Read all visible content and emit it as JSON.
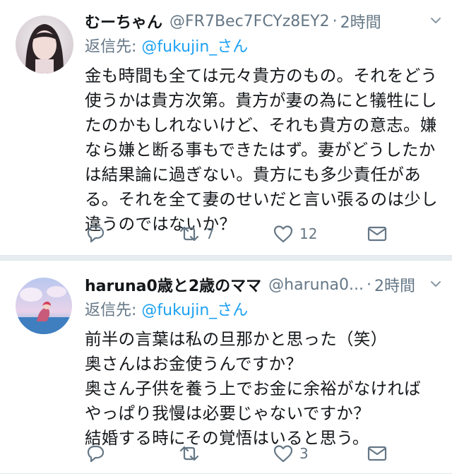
{
  "tweets": [
    {
      "name": "むーちゃん",
      "handle": "@FR7Bec7FCYz8EY2",
      "dot": "·",
      "time": "2時間",
      "reply_prefix": "返信先: ",
      "reply_mention": "@fukujin_さん",
      "body_lines": [
        "金も時間も全ては元々貴方のもの。それをどう",
        "使うかは貴方次第。貴方が妻の為にと犠牲にし",
        "たのかもしれないけど、それも貴方の意志。嫌",
        "なら嫌と断る事もできたはず。妻がどうしたか",
        "は結果論に過ぎない。貴方にも多少責任があ",
        "る。それを全て妻のせいだと言い張るのは少し",
        "違うのではないか？"
      ],
      "reply_count": "",
      "retweet_count": "7",
      "like_count": "12"
    },
    {
      "name": "haruna0歳と2歳のママ",
      "handle": "@haruna0...",
      "dot": "·",
      "time": "2時間",
      "reply_prefix": "返信先: ",
      "reply_mention": "@fukujin_さん",
      "body_lines": [
        "前半の言葉は私の旦那かと思った（笑）",
        "奥さんはお金使うんですか？",
        "奥さん子供を養う上でお金に余裕がなければ",
        "やっぱり我慢は必要じゃないですか？",
        "結婚する時にその覚悟はいると思う。"
      ],
      "reply_count": "",
      "retweet_count": "",
      "like_count": "3"
    }
  ],
  "icons": {
    "reply": "reply-icon",
    "retweet": "retweet-icon",
    "like": "heart-icon",
    "dm": "envelope-icon",
    "caret": "chevron-down-icon"
  },
  "colors": {
    "text": "#14171a",
    "secondary": "#657786",
    "link": "#1da1f2",
    "divider": "#e1e8ed"
  }
}
